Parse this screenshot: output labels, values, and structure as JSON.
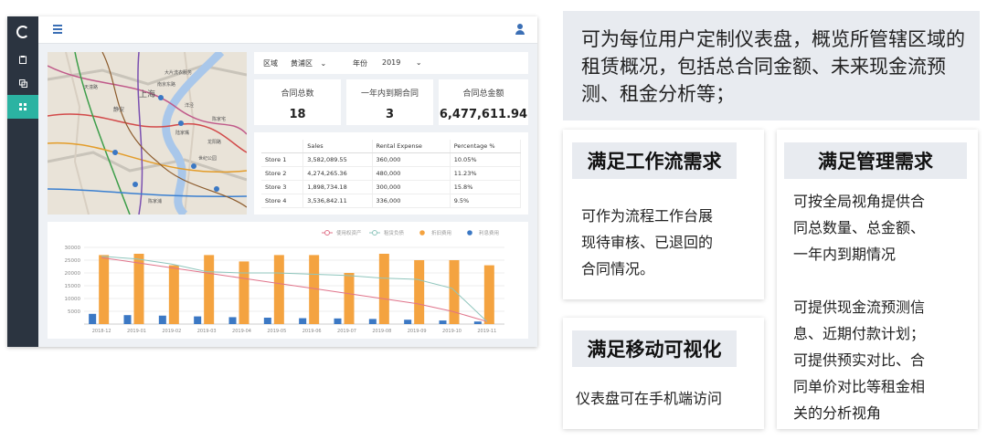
{
  "dashboard": {
    "sidebar": [
      {
        "icon": "clipboard-icon"
      },
      {
        "icon": "copy-icon"
      },
      {
        "icon": "grid-icon",
        "active": true
      }
    ],
    "map": {
      "labels": [
        "上海",
        "静安",
        "南京东路",
        "天潼路",
        "大片洗衣服务",
        "洋泾",
        "世纪公园",
        "龙阳路",
        "陆家嘴",
        "陈家宅",
        "陈家浦"
      ]
    },
    "filter": {
      "region_label": "区域",
      "region_value": "黄浦区",
      "year_label": "年份",
      "year_value": "2019"
    },
    "kpis": [
      {
        "title": "合同总数",
        "value": "18"
      },
      {
        "title": "一年内到期合同",
        "value": "3"
      },
      {
        "title": "合同总金额",
        "value": "6,477,611.94"
      }
    ],
    "table": {
      "headers": [
        "",
        "Sales",
        "Rental Expense",
        "Percentage %"
      ],
      "rows": [
        [
          "Store 1",
          "3,582,089.55",
          "360,000",
          "10.05%"
        ],
        [
          "Store 2",
          "4,274,265.36",
          "480,000",
          "11.23%"
        ],
        [
          "Store 3",
          "1,898,734.18",
          "300,000",
          "15.8%"
        ],
        [
          "Store 4",
          "3,536,842.11",
          "336,000",
          "9.5%"
        ]
      ]
    }
  },
  "chart_data": {
    "type": "bar",
    "categories": [
      "2018-12",
      "2019-01",
      "2019-02",
      "2019-03",
      "2019-04",
      "2019-05",
      "2019-06",
      "2019-07",
      "2019-08",
      "2019-09",
      "2019-10",
      "2019-11"
    ],
    "ylim": [
      0,
      30000
    ],
    "yticks": [
      5000,
      10000,
      15000,
      20000,
      25000,
      30000
    ],
    "legend": [
      "使用权资产",
      "租赁负债",
      "折旧费用",
      "利息费用"
    ],
    "legend_position": "top-right",
    "series": [
      {
        "name": "使用权资产",
        "kind": "line",
        "color": "#e0738a",
        "values": [
          26000,
          24000,
          22000,
          20000,
          18000,
          16000,
          14000,
          12000,
          10000,
          8000,
          5000,
          1000
        ]
      },
      {
        "name": "租赁负债",
        "kind": "line",
        "color": "#8fc6bd",
        "values": [
          26500,
          25500,
          23500,
          20500,
          20000,
          20000,
          19500,
          19000,
          18000,
          17500,
          14000,
          1000
        ]
      },
      {
        "name": "折旧费用",
        "kind": "bar",
        "color": "#f4a340",
        "values": [
          27000,
          27500,
          23000,
          27000,
          24500,
          27000,
          27000,
          20000,
          27500,
          25000,
          25000,
          23000
        ]
      },
      {
        "name": "利息费用",
        "kind": "bar",
        "color": "#3b78c4",
        "values": [
          4000,
          3500,
          3300,
          3000,
          2700,
          2500,
          2300,
          2200,
          2000,
          1700,
          1400,
          1000
        ]
      }
    ]
  },
  "panels": {
    "intro": "可为每位用户定制仪表盘，概览所管辖区域的租赁概况，包括总合同金额、未来现金流预测、租金分析等；",
    "workflow": {
      "title": "满足工作流需求",
      "lines": [
        "可作为流程工作台展",
        "现待审核、已退回的",
        "合同情况。"
      ]
    },
    "management": {
      "title": "满足管理需求",
      "lines": [
        "可按全局视角提供合",
        "同总数量、总金额、",
        "一年内到期情况",
        "",
        "可提供现金流预测信",
        "息、近期付款计划；",
        "可提供预实对比、合",
        "同单价对比等租金相",
        "关的分析视角"
      ]
    },
    "mobile": {
      "title": "满足移动可视化",
      "lines": [
        "仪表盘可在手机端访问"
      ]
    }
  }
}
